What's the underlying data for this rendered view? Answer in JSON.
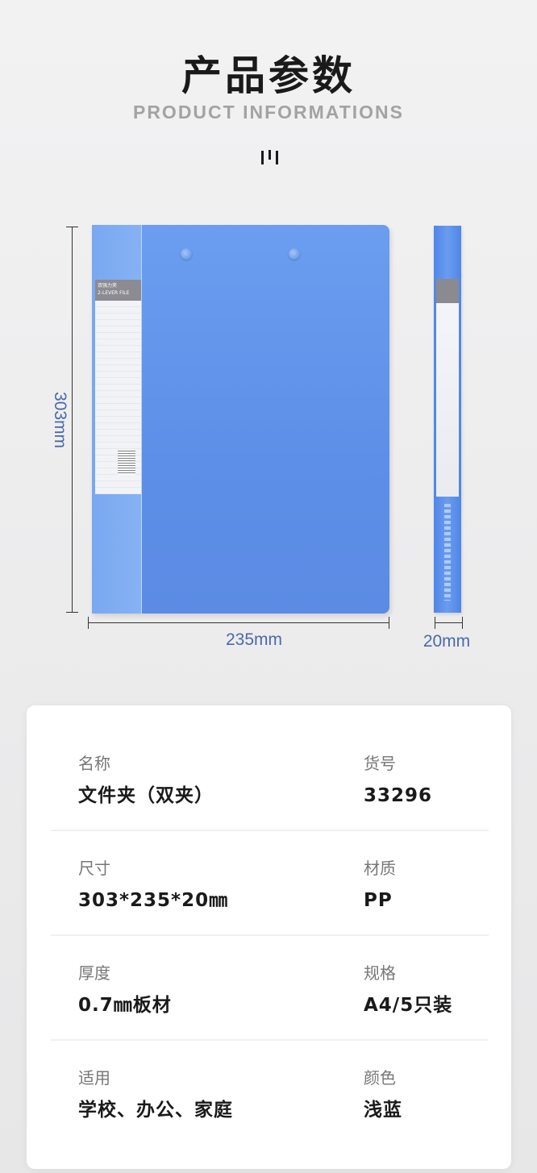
{
  "header": {
    "title": "产品参数",
    "subtitle": "PRODUCT INFORMATIONS"
  },
  "dimensions": {
    "height": "303mm",
    "width": "235mm",
    "thickness": "20mm"
  },
  "folder_label": {
    "cn": "双强力夹",
    "en": "2-LEVER FILE"
  },
  "specs": [
    {
      "left_label": "名称",
      "left_value": "文件夹（双夹）",
      "right_label": "货号",
      "right_value": "33296"
    },
    {
      "left_label": "尺寸",
      "left_value": "303*235*20㎜",
      "right_label": "材质",
      "right_value": "PP"
    },
    {
      "left_label": "厚度",
      "left_value": "0.7㎜板材",
      "right_label": "规格",
      "right_value": "A4/5只装"
    },
    {
      "left_label": "适用",
      "left_value": "学校、办公、家庭",
      "right_label": "颜色",
      "right_value": "浅蓝"
    }
  ],
  "colors": {
    "folder_blue": "#5d8fe8",
    "dimension_text": "#4a6aa8"
  }
}
